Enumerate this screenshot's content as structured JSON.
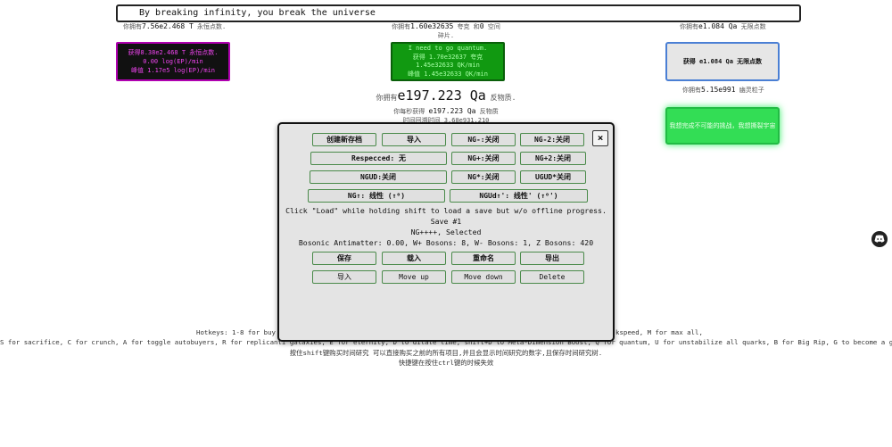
{
  "news": {
    "text": "By breaking infinity, you break the universe"
  },
  "eternity": {
    "points_label_prefix": "你拥有",
    "points_value": "7.56e2.468 T",
    "points_label_suffix": "永恒点数.",
    "button_line1": "获得8.38e2.468 T 永恒点数.",
    "button_line2": "0.00 log(EP)/min",
    "button_line3": "峰值 1.17e5 log(EP)/min"
  },
  "quantum": {
    "top_prefix": "你拥有",
    "top_value1": "1.60e32635",
    "top_mid": "夸克 和",
    "top_value2": "0",
    "top_suffix": "空间碎片.",
    "button_line1": "I need to go quantum.",
    "button_line2": "获得 1.70e32637 夸克",
    "button_line3": "1.45e32633 QK/min",
    "button_line4": "峰值 1.45e32633 QK/min"
  },
  "infinity": {
    "points_prefix": "你拥有",
    "points_value": "e1.084 Qa",
    "points_suffix": "无限点数",
    "button_label": "获得 e1.084 Qa 无限点数",
    "ghost_prefix": "你拥有",
    "ghost_value": "5.15e991",
    "ghost_suffix": "幽灵粒子",
    "ghost_button": "我想完成不可能的挑战，我想撕裂宇宙"
  },
  "antimatter": {
    "prefix": "你拥有",
    "value": "e197.223 Qa",
    "suffix": "反物质.",
    "per_sec_prefix": "你每秒获得",
    "per_sec_value": "e197.223 Qa",
    "per_sec_suffix": "反物质",
    "time_line": "时间回溯时间 3.68e931.210"
  },
  "modal": {
    "row1": [
      "创建新存档",
      "导入",
      "NG-:关闭",
      "NG-2:关闭"
    ],
    "row2": [
      "Respecced: 无",
      "NG+:关闭",
      "NG+2:关闭"
    ],
    "row3": [
      "NGUD:关闭",
      "NG*:关闭",
      "UGUD*关闭"
    ],
    "row4": [
      "NG↑: 线性 (↑⁰)",
      "NGUd↑': 线性' (↑⁰')"
    ],
    "close": "×",
    "hint": "Click \"Load\" while holding shift to load a save but w/o offline progress.",
    "save_title": "Save #1",
    "save_mode": "NG++++, Selected",
    "save_stats": "Bosonic Antimatter: 0.00, W+ Bosons: 8, W- Bosons: 1, Z Bosons: 420",
    "save_actions": [
      "保存",
      "载入",
      "重命名",
      "导出"
    ],
    "save_actions2": [
      "导入",
      "Move up",
      "Move down",
      "Delete"
    ]
  },
  "hotkeys": {
    "line1_left": "Hotkeys: 1-8 for buy 1",
    "line1_right": "kspeed, M for max all,",
    "line2": "S for sacrifice, C for crunch, A for toggle autobuyers, R for replicanti galaxies, E for eternity, D to dilate time, shift+D to Meta-Dimension Boost, Q for quantum, U for unstabilize all quarks, B for Big Rip, G to become a ghost.",
    "line3": "按住shift键购买时间研究 可以直接购买之前的所有项目,并且会显示时间研究的数字,且保存时间研究树.",
    "line4": "快捷键在按住ctrl键的时候失效"
  }
}
